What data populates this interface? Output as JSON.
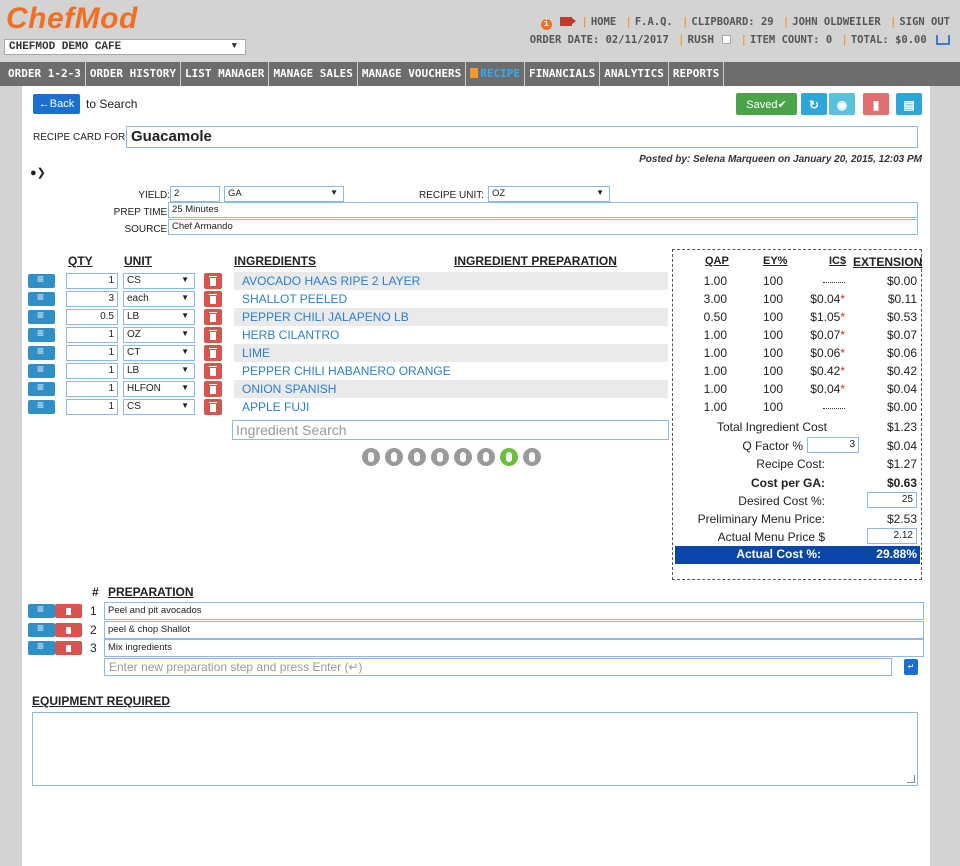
{
  "header": {
    "logo": "ChefMod",
    "cafe": "CHEFMOD DEMO CAFE",
    "links": [
      "HOME",
      "F.A.Q.",
      "CLIPBOARD: 29",
      "JOHN OLDWEILER",
      "SIGN OUT"
    ],
    "order_date": "ORDER DATE: 02/11/2017",
    "rush": "RUSH",
    "item_count": "ITEM COUNT: 0",
    "total": "TOTAL: $0.00"
  },
  "nav": {
    "tabs": [
      "ORDER 1-2-3",
      "ORDER HISTORY",
      "LIST MANAGER",
      "MANAGE SALES",
      "MANAGE VOUCHERS",
      "RECIPE",
      "FINANCIALS",
      "ANALYTICS",
      "REPORTS"
    ]
  },
  "toolbar": {
    "back": "←Back",
    "to_search": "to Search",
    "saved": "Saved✔"
  },
  "recipe": {
    "card_label": "RECIPE CARD FOR:",
    "name": "Guacamole",
    "posted": "Posted by: Selena Marqueen on January 20, 2015, 12:03 PM",
    "yield_label": "YIELD:",
    "yield_value": "2",
    "yield_unit": "GA",
    "recipe_unit_label": "RECIPE UNIT:",
    "recipe_unit": "OZ",
    "prep_time_label": "PREP TIME:",
    "prep_time": "25 Minutes",
    "source_label": "SOURCE:",
    "source": "Chef Armando"
  },
  "ingredients": {
    "headers": {
      "qty": "QTY",
      "unit": "UNIT",
      "ingredients": "INGREDIENTS",
      "prep": "INGREDIENT PREPARATION"
    },
    "rows": [
      {
        "qty": "1",
        "unit": "CS",
        "name": "AVOCADO HAAS RIPE 2 LAYER"
      },
      {
        "qty": "3",
        "unit": "each",
        "name": "SHALLOT PEELED"
      },
      {
        "qty": "0.5",
        "unit": "LB",
        "name": "PEPPER CHILI JALAPENO LB"
      },
      {
        "qty": "1",
        "unit": "OZ",
        "name": "HERB CILANTRO"
      },
      {
        "qty": "1",
        "unit": "CT",
        "name": "LIME"
      },
      {
        "qty": "1",
        "unit": "LB",
        "name": "PEPPER CHILI HABANERO ORANGE"
      },
      {
        "qty": "1",
        "unit": "HLFON",
        "name": "ONION SPANISH"
      },
      {
        "qty": "1",
        "unit": "CS",
        "name": "APPLE FUJI"
      }
    ],
    "search_placeholder": "Ingredient Search"
  },
  "costs": {
    "headers": {
      "qap": "QAP",
      "ey": "EY%",
      "ics": "IC$",
      "ext": "EXTENSION"
    },
    "rows": [
      {
        "qap": "1.00",
        "ey": "100",
        "ics": "",
        "ext": "$0.00"
      },
      {
        "qap": "3.00",
        "ey": "100",
        "ics": "$0.04",
        "ext": "$0.11"
      },
      {
        "qap": "0.50",
        "ey": "100",
        "ics": "$1.05",
        "ext": "$0.53"
      },
      {
        "qap": "1.00",
        "ey": "100",
        "ics": "$0.07",
        "ext": "$0.07"
      },
      {
        "qap": "1.00",
        "ey": "100",
        "ics": "$0.06",
        "ext": "$0.06"
      },
      {
        "qap": "1.00",
        "ey": "100",
        "ics": "$0.42",
        "ext": "$0.42"
      },
      {
        "qap": "1.00",
        "ey": "100",
        "ics": "$0.04",
        "ext": "$0.04"
      },
      {
        "qap": "1.00",
        "ey": "100",
        "ics": "",
        "ext": "$0.00"
      }
    ],
    "total_ingredient_label": "Total Ingredient Cost",
    "total_ingredient": "$1.23",
    "qfactor_label": "Q Factor %",
    "qfactor_input": "3",
    "qfactor": "$0.04",
    "recipe_cost_label": "Recipe Cost:",
    "recipe_cost": "$1.27",
    "cost_per_label": "Cost per GA:",
    "cost_per": "$0.63",
    "desired_label": "Desired Cost %:",
    "desired": "25",
    "prelim_label": "Preliminary Menu Price:",
    "prelim": "$2.53",
    "actual_price_label": "Actual Menu Price $",
    "actual_price": "2.12",
    "actual_cost_label": "Actual Cost %:",
    "actual_cost": "29.88%"
  },
  "preparation": {
    "hash": "#",
    "label": "PREPARATION",
    "steps": [
      {
        "num": "1",
        "text": "Peel and pit avocados"
      },
      {
        "num": "2",
        "text": "peel & chop Shallot"
      },
      {
        "num": "3",
        "text": "Mix ingredients"
      }
    ],
    "new_placeholder": "Enter new preparation step and press Enter (↵)"
  },
  "equipment": {
    "label": "EQUIPMENT REQUIRED"
  }
}
